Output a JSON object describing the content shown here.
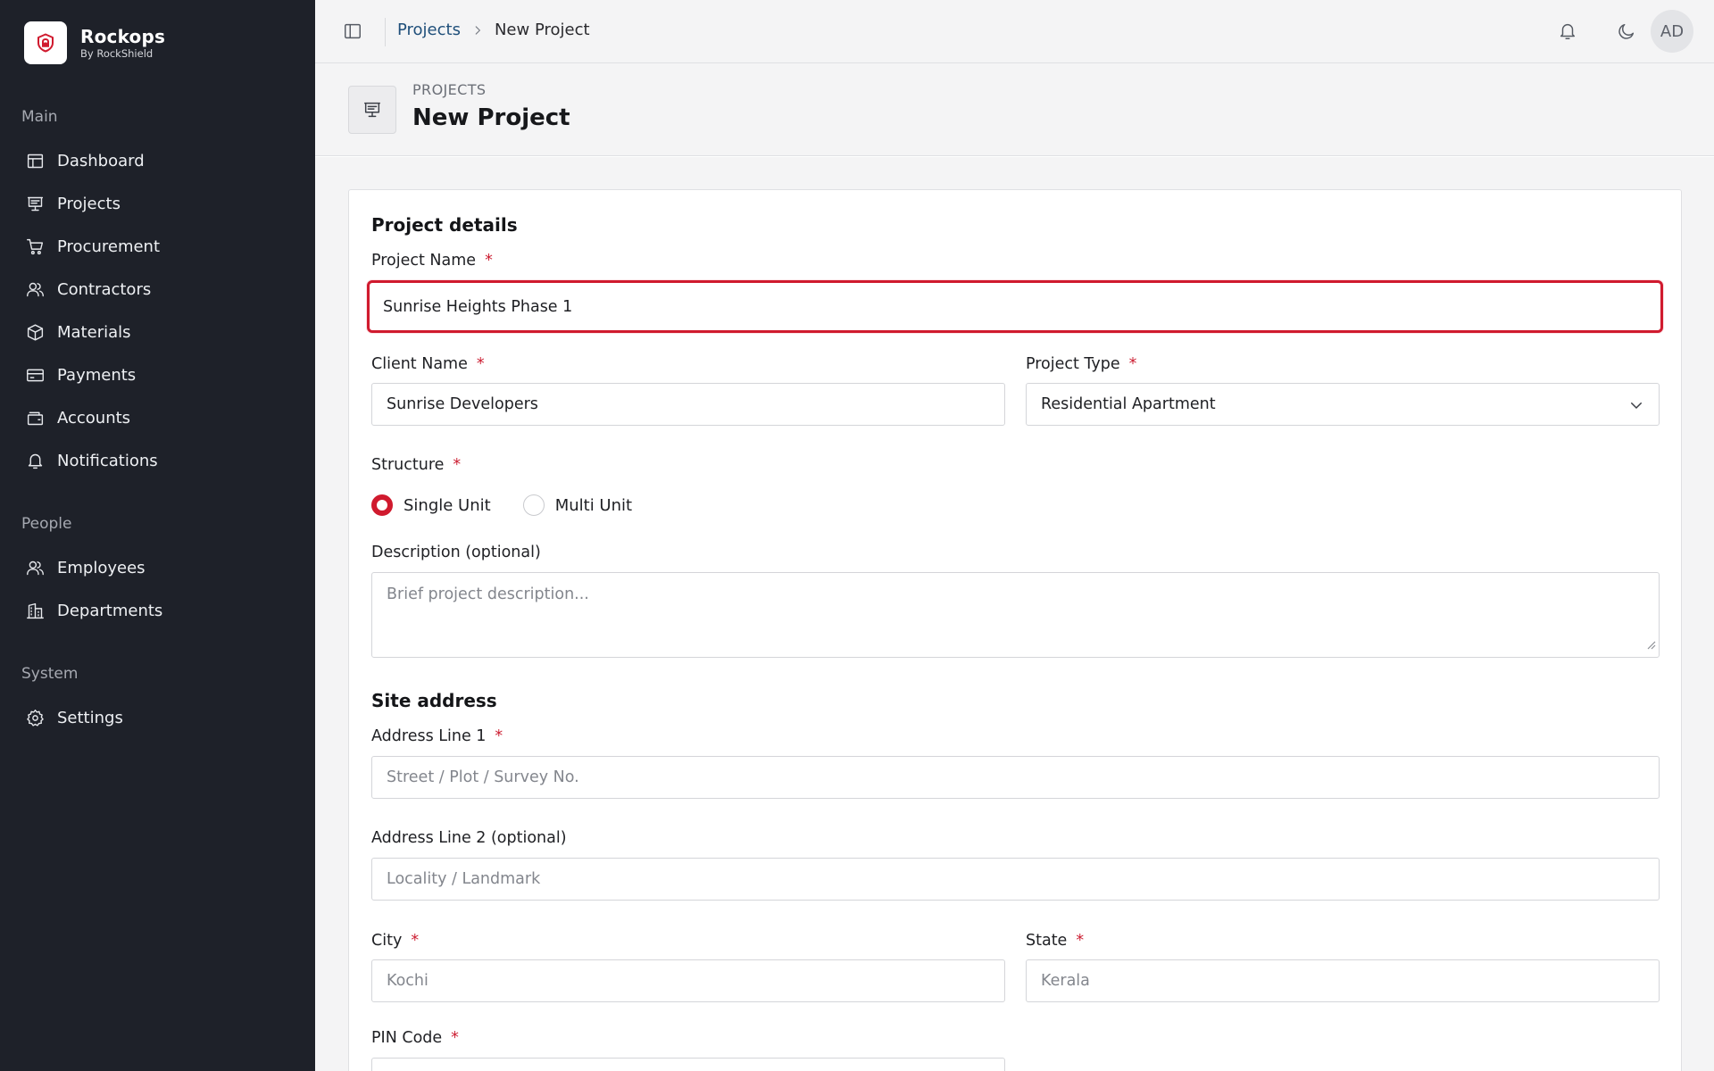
{
  "brand": {
    "name": "Rockops",
    "subtitle": "By RockShield"
  },
  "sidebar": {
    "sections": [
      {
        "label": "Main"
      },
      {
        "label": "People"
      },
      {
        "label": "System"
      }
    ],
    "items": [
      {
        "label": "Dashboard",
        "icon": "dashboard-icon"
      },
      {
        "label": "Projects",
        "icon": "projects-icon"
      },
      {
        "label": "Procurement",
        "icon": "cart-icon"
      },
      {
        "label": "Contractors",
        "icon": "users-icon"
      },
      {
        "label": "Materials",
        "icon": "box-icon"
      },
      {
        "label": "Payments",
        "icon": "card-icon"
      },
      {
        "label": "Accounts",
        "icon": "wallet-icon"
      },
      {
        "label": "Notifications",
        "icon": "bell-icon"
      },
      {
        "label": "Employees",
        "icon": "users-icon"
      },
      {
        "label": "Departments",
        "icon": "building-icon"
      },
      {
        "label": "Settings",
        "icon": "gear-icon"
      }
    ]
  },
  "topbar": {
    "breadcrumb": {
      "parent": "Projects",
      "current": "New Project"
    },
    "avatar_initials": "AD"
  },
  "page_header": {
    "eyebrow": "PROJECTS",
    "title": "New Project"
  },
  "form": {
    "project_details_title": "Project details",
    "project_name": {
      "label": "Project Name",
      "required": "*",
      "value": "Sunrise Heights Phase 1"
    },
    "client_name": {
      "label": "Client Name",
      "required": "*",
      "value": "Sunrise Developers"
    },
    "project_type": {
      "label": "Project Type",
      "required": "*",
      "value": "Residential Apartment"
    },
    "structure": {
      "label": "Structure",
      "required": "*",
      "options": [
        "Single Unit",
        "Multi Unit"
      ],
      "selected": "Single Unit"
    },
    "description": {
      "label": "Description (optional)",
      "placeholder": "Brief project description..."
    },
    "site_address_title": "Site address",
    "address_line1": {
      "label": "Address Line 1",
      "required": "*",
      "placeholder": "Street / Plot / Survey No."
    },
    "address_line2": {
      "label": "Address Line 2 (optional)",
      "placeholder": "Locality / Landmark"
    },
    "city": {
      "label": "City",
      "required": "*",
      "placeholder": "Kochi"
    },
    "state": {
      "label": "State",
      "required": "*",
      "placeholder": "Kerala"
    },
    "pin_code": {
      "label": "PIN Code",
      "required": "*"
    }
  },
  "colors": {
    "accent": "#d01a2e",
    "sidebar_bg": "#1e2129",
    "link": "#1f4f7a"
  }
}
